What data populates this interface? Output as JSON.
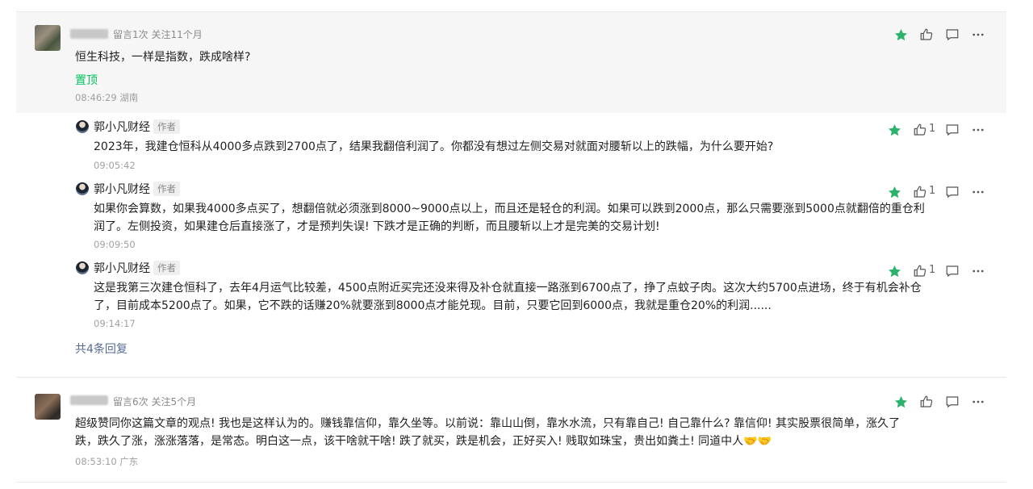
{
  "colors": {
    "accent": "#07c160",
    "link": "#576b95",
    "star": "#2cb36b"
  },
  "icons": [
    "star-icon",
    "thumbs-up-icon",
    "comment-icon",
    "more-icon"
  ],
  "comments": [
    {
      "meta": "留言1次 关注11个月",
      "text": "恒生科技，一样是指数，跌成啥样?",
      "pin_label": "置顶",
      "time": "08:46:29 湖南",
      "replies": [
        {
          "author": "郭小凡财经",
          "tag": "作者",
          "text": "2023年，我建仓恒科从4000多点跌到2700点了，结果我翻倍利润了。你都没有想过左侧交易对就面对腰斩以上的跌幅，为什么要开始?",
          "time": "09:05:42",
          "likes": "1"
        },
        {
          "author": "郭小凡财经",
          "tag": "作者",
          "text_line1": "如果你会算数，如果我4000多点买了，想翻倍就必须涨到8000~9000点以上，而且还是轻仓的利润。如果可以跌到2000点，那么只需要涨到5000点就翻倍的重仓利",
          "text_line2": "润了。左侧投资，如果建仓后直接涨了，才是预判失误! 下跌才是正确的判断，而且腰斩以上才是完美的交易计划!",
          "time": "09:09:50",
          "likes": "1"
        },
        {
          "author": "郭小凡财经",
          "tag": "作者",
          "text_line1": "这是我第三次建仓恒科了，去年4月运气比较差，4500点附近买完还没来得及补仓就直接一路涨到6700点了，挣了点蚊子肉。这次大约5700点进场，终于有机会补仓",
          "text_line2": "了，目前成本5200点了。如果，它不跌的话赚20%就要涨到8000点才能兑现。目前，只要它回到6000点，我就是重仓20%的利润......",
          "time": "09:14:17",
          "likes": "1"
        }
      ],
      "more_replies": "共4条回复"
    },
    {
      "meta": "留言6次 关注5个月",
      "text_line1": "超级赞同你这篇文章的观点! 我也是这样认为的。赚钱靠信仰，靠久坐等。以前说：靠山山倒，靠水水流，只有靠自己! 自己靠什么? 靠信仰! 其实股票很简单，涨久了",
      "text_line2": "跌，跌久了涨，涨涨落落，是常态。明白这一点，该干啥就干啥! 跌了就买，跌是机会，正好买入! 贱取如珠宝，贵出如粪土! 同道中人",
      "emoji": "🤝🤝",
      "time": "08:53:10 广东"
    }
  ]
}
